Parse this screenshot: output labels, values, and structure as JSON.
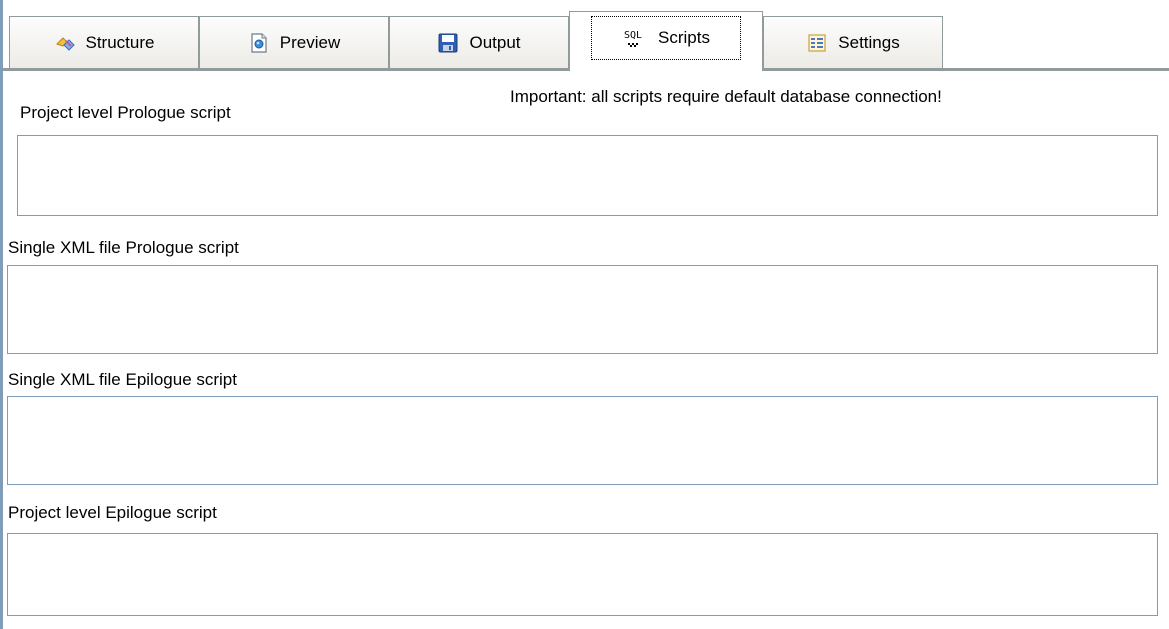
{
  "tabs": [
    {
      "label": "Structure",
      "icon": "structure-icon",
      "active": false
    },
    {
      "label": "Preview",
      "icon": "preview-icon",
      "active": false
    },
    {
      "label": "Output",
      "icon": "save-disk-icon",
      "active": false
    },
    {
      "label": "Scripts",
      "icon": "sql-icon",
      "active": true
    },
    {
      "label": "Settings",
      "icon": "settings-icon",
      "active": false
    }
  ],
  "notice": "Important: all scripts require default database connection!",
  "scripts": [
    {
      "label": "Project level Prologue script",
      "value": ""
    },
    {
      "label": "Single XML file Prologue script",
      "value": ""
    },
    {
      "label": "Single XML file Epilogue script",
      "value": ""
    },
    {
      "label": "Project level Epilogue script",
      "value": ""
    }
  ],
  "colors": {
    "tab_border": "#919b9c",
    "field_border": "#7f9db9",
    "background": "#ffffff"
  }
}
